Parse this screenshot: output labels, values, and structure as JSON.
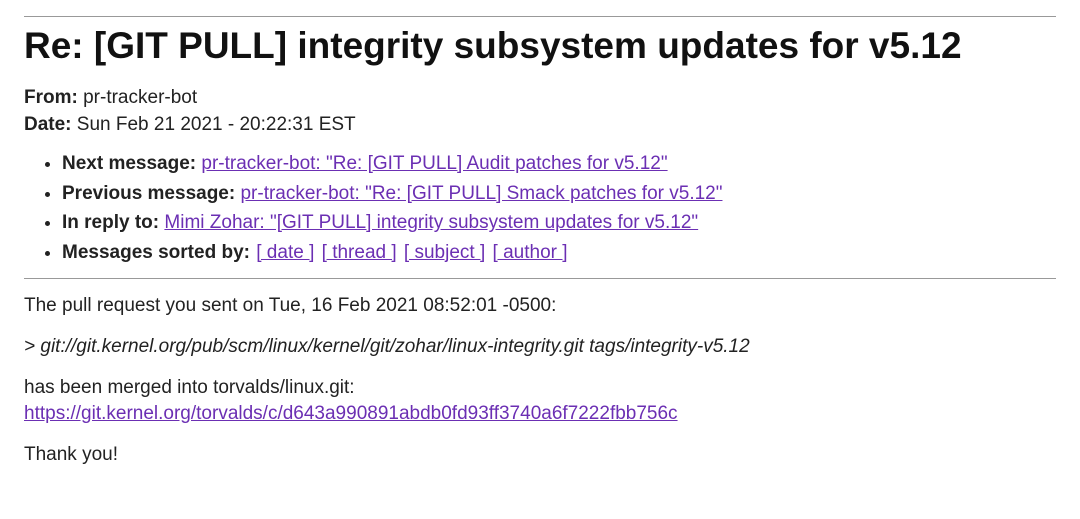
{
  "title": "Re: [GIT PULL] integrity subsystem updates for v5.12",
  "meta": {
    "from_label": "From:",
    "from_value": "pr-tracker-bot",
    "date_label": "Date:",
    "date_value": "Sun Feb 21 2021 - 20:22:31 EST"
  },
  "nav": {
    "next_label": "Next message:",
    "next_link": "pr-tracker-bot: \"Re: [GIT PULL] Audit patches for v5.12\"",
    "prev_label": "Previous message:",
    "prev_link": "pr-tracker-bot: \"Re: [GIT PULL] Smack patches for v5.12\"",
    "reply_label": "In reply to:",
    "reply_link": "Mimi Zohar: \"[GIT PULL] integrity subsystem updates for v5.12\"",
    "sort_label": "Messages sorted by:",
    "sort_date": "[ date ]",
    "sort_thread": "[ thread ]",
    "sort_subject": "[ subject ]",
    "sort_author": "[ author ]"
  },
  "body": {
    "intro": "The pull request you sent on Tue, 16 Feb 2021 08:52:01 -0500:",
    "quote_prefix": "> ",
    "quote_text": "git://git.kernel.org/pub/scm/linux/kernel/git/zohar/linux-integrity.git tags/integrity-v5.12",
    "merged_text": "has been merged into torvalds/linux.git:",
    "merged_link": "https://git.kernel.org/torvalds/c/d643a990891abdb0fd93ff3740a6f7222fbb756c",
    "thanks": "Thank you!"
  }
}
